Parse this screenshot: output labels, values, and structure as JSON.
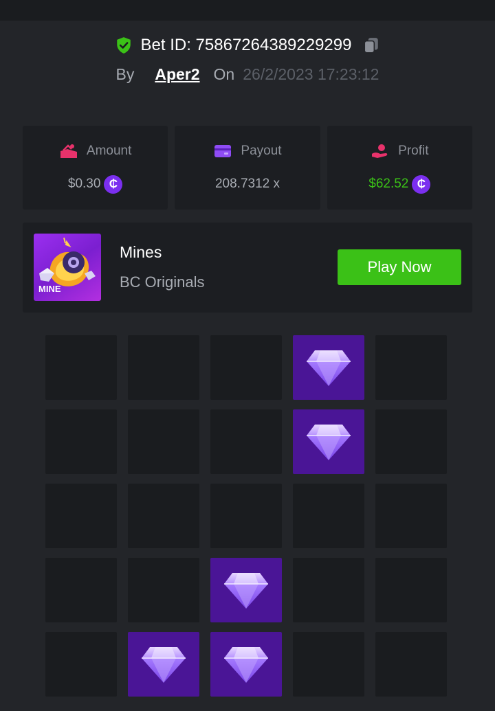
{
  "bet": {
    "label": "Bet ID: 75867264389229299",
    "by_label": "By",
    "username": "Aper2",
    "on_label": "On",
    "datetime": "26/2/2023 17:23:12"
  },
  "stats": {
    "amount": {
      "label": "Amount",
      "value": "$0.30"
    },
    "payout": {
      "label": "Payout",
      "value": "208.7312 x"
    },
    "profit": {
      "label": "Profit",
      "value": "$62.52"
    },
    "coin_symbol": "₵"
  },
  "game": {
    "name": "Mines",
    "provider": "BC Originals",
    "thumb_label": "MINE",
    "play_label": "Play Now"
  },
  "board": {
    "rows": [
      [
        0,
        0,
        0,
        1,
        0
      ],
      [
        0,
        0,
        0,
        1,
        0
      ],
      [
        0,
        0,
        0,
        0,
        0
      ],
      [
        0,
        0,
        1,
        0,
        0
      ],
      [
        0,
        1,
        1,
        0,
        0
      ]
    ]
  },
  "colors": {
    "accent_green": "#3bc117",
    "gem_tile": "#4a1596",
    "coin": "#7b2ff0"
  }
}
